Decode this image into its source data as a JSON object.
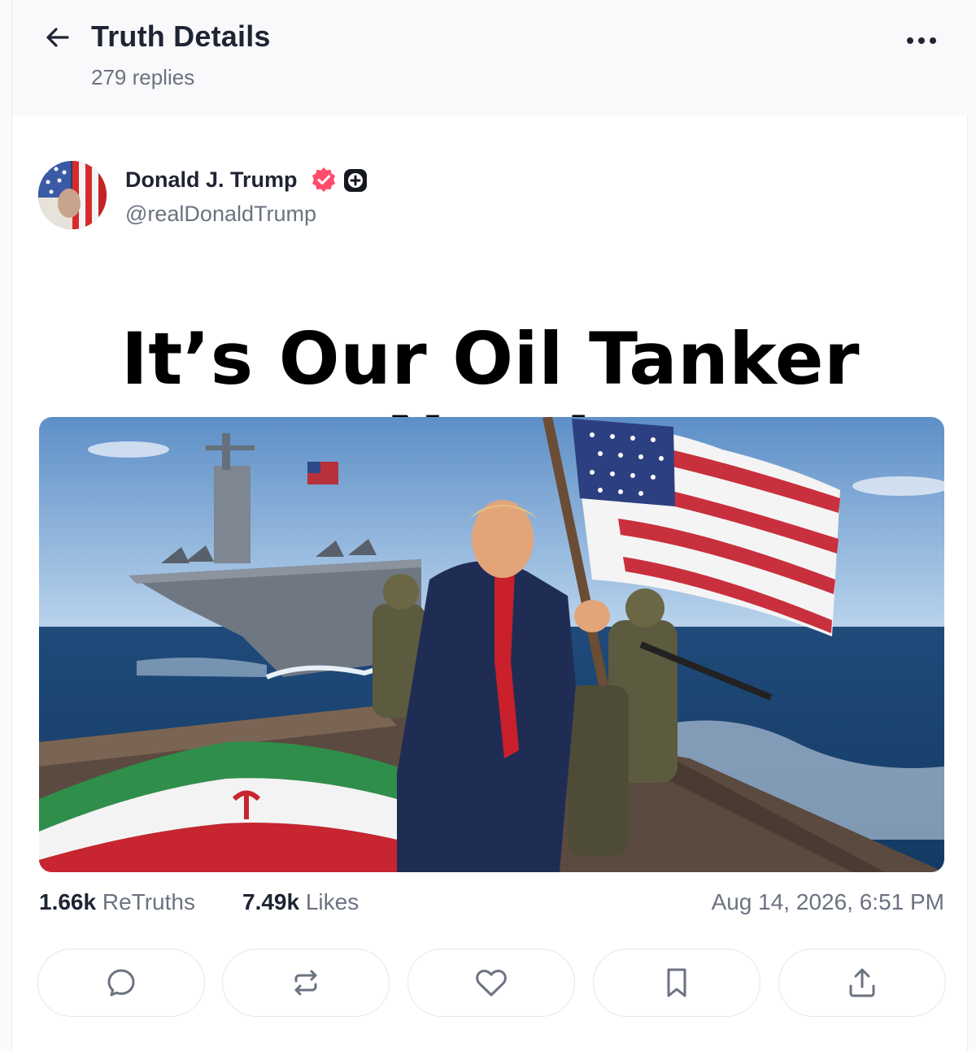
{
  "header": {
    "title": "Truth Details",
    "replies": "279 replies"
  },
  "post": {
    "author_name": "Donald J. Trump",
    "handle": "@realDonaldTrump",
    "headline": "It’s Our Oil Tanker Now!",
    "image_icon": "photo-illustration",
    "retruths_count": "1.66k",
    "retruths_label": "ReTruths",
    "likes_count": "7.49k",
    "likes_label": "Likes",
    "timestamp": "Aug 14, 2026, 6:51 PM"
  },
  "colors": {
    "verified": "#ff4d6d",
    "text_primary": "#1e2433",
    "text_secondary": "#6b7280"
  },
  "actions": [
    "reply-icon",
    "retruth-icon",
    "like-icon",
    "bookmark-icon",
    "share-icon"
  ]
}
